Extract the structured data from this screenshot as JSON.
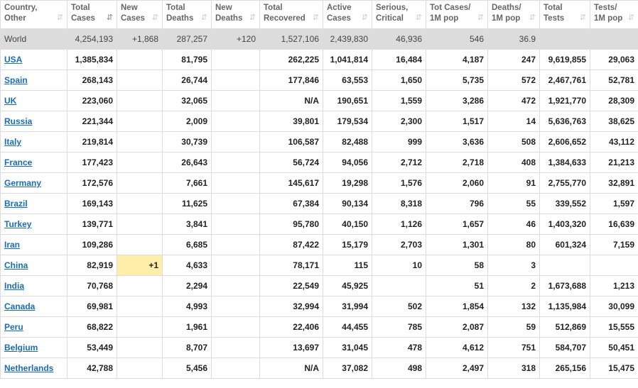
{
  "headers": [
    {
      "l1": "Country,",
      "l2": "Other"
    },
    {
      "l1": "Total",
      "l2": "Cases"
    },
    {
      "l1": "New",
      "l2": "Cases"
    },
    {
      "l1": "Total",
      "l2": "Deaths"
    },
    {
      "l1": "New",
      "l2": "Deaths"
    },
    {
      "l1": "Total",
      "l2": "Recovered"
    },
    {
      "l1": "Active",
      "l2": "Cases"
    },
    {
      "l1": "Serious,",
      "l2": "Critical"
    },
    {
      "l1": "Tot Cases/",
      "l2": "1M pop"
    },
    {
      "l1": "Deaths/",
      "l2": "1M pop"
    },
    {
      "l1": "Total",
      "l2": "Tests"
    },
    {
      "l1": "Tests/",
      "l2": "1M pop"
    }
  ],
  "sort_icons": {
    "default": "⇵",
    "active": "⇵"
  },
  "colors": {
    "world_row": "#dcdcdc",
    "new_cases_highlight": "#ffeeaa",
    "country_link": "#1a6db5"
  },
  "world": [
    "World",
    "4,254,193",
    "+1,868",
    "287,257",
    "+120",
    "1,527,106",
    "2,439,830",
    "46,936",
    "546",
    "36.9",
    "",
    ""
  ],
  "rows": [
    [
      "USA",
      "1,385,834",
      "",
      "81,795",
      "",
      "262,225",
      "1,041,814",
      "16,484",
      "4,187",
      "247",
      "9,619,855",
      "29,063"
    ],
    [
      "Spain",
      "268,143",
      "",
      "26,744",
      "",
      "177,846",
      "63,553",
      "1,650",
      "5,735",
      "572",
      "2,467,761",
      "52,781"
    ],
    [
      "UK",
      "223,060",
      "",
      "32,065",
      "",
      "N/A",
      "190,651",
      "1,559",
      "3,286",
      "472",
      "1,921,770",
      "28,309"
    ],
    [
      "Russia",
      "221,344",
      "",
      "2,009",
      "",
      "39,801",
      "179,534",
      "2,300",
      "1,517",
      "14",
      "5,636,763",
      "38,625"
    ],
    [
      "Italy",
      "219,814",
      "",
      "30,739",
      "",
      "106,587",
      "82,488",
      "999",
      "3,636",
      "508",
      "2,606,652",
      "43,112"
    ],
    [
      "France",
      "177,423",
      "",
      "26,643",
      "",
      "56,724",
      "94,056",
      "2,712",
      "2,718",
      "408",
      "1,384,633",
      "21,213"
    ],
    [
      "Germany",
      "172,576",
      "",
      "7,661",
      "",
      "145,617",
      "19,298",
      "1,576",
      "2,060",
      "91",
      "2,755,770",
      "32,891"
    ],
    [
      "Brazil",
      "169,143",
      "",
      "11,625",
      "",
      "67,384",
      "90,134",
      "8,318",
      "796",
      "55",
      "339,552",
      "1,597"
    ],
    [
      "Turkey",
      "139,771",
      "",
      "3,841",
      "",
      "95,780",
      "40,150",
      "1,126",
      "1,657",
      "46",
      "1,403,320",
      "16,639"
    ],
    [
      "Iran",
      "109,286",
      "",
      "6,685",
      "",
      "87,422",
      "15,179",
      "2,703",
      "1,301",
      "80",
      "601,324",
      "7,159"
    ],
    [
      "China",
      "82,919",
      "+1",
      "4,633",
      "",
      "78,171",
      "115",
      "10",
      "58",
      "3",
      "",
      ""
    ],
    [
      "India",
      "70,768",
      "",
      "2,294",
      "",
      "22,549",
      "45,925",
      "",
      "51",
      "2",
      "1,673,688",
      "1,213"
    ],
    [
      "Canada",
      "69,981",
      "",
      "4,993",
      "",
      "32,994",
      "31,994",
      "502",
      "1,854",
      "132",
      "1,135,984",
      "30,099"
    ],
    [
      "Peru",
      "68,822",
      "",
      "1,961",
      "",
      "22,406",
      "44,455",
      "785",
      "2,087",
      "59",
      "512,869",
      "15,555"
    ],
    [
      "Belgium",
      "53,449",
      "",
      "8,707",
      "",
      "13,697",
      "31,045",
      "478",
      "4,612",
      "751",
      "584,707",
      "50,451"
    ],
    [
      "Netherlands",
      "42,788",
      "",
      "5,456",
      "",
      "N/A",
      "37,082",
      "498",
      "2,497",
      "318",
      "265,156",
      "15,475"
    ]
  ]
}
